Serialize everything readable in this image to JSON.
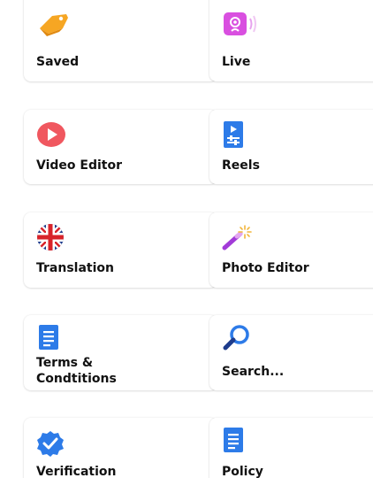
{
  "menu": {
    "items": [
      {
        "label": "Saved",
        "icon": "tag-icon",
        "color": "#F6A623"
      },
      {
        "label": "Live",
        "icon": "live-broadcast-icon",
        "color": "#D94FE0"
      },
      {
        "label": "Video Editor",
        "icon": "play-icon",
        "color": "#F0575F"
      },
      {
        "label": "Reels",
        "icon": "reels-icon",
        "color": "#2D7BE8"
      },
      {
        "label": "Translation",
        "icon": "uk-flag-icon",
        "color": "#1E3C8C"
      },
      {
        "label": "Photo Editor",
        "icon": "magic-wand-icon",
        "color": "#A23BD8"
      },
      {
        "label": "Terms &\nCondtitions",
        "label_line1": "Terms &",
        "label_line2": "Condtitions",
        "icon": "document-icon",
        "color": "#2D7BE8"
      },
      {
        "label": "Search...",
        "icon": "search-icon",
        "color": "#2D7BE8"
      },
      {
        "label": "Verification",
        "icon": "verified-badge-icon",
        "color": "#2D7BE8"
      },
      {
        "label": "Policy",
        "icon": "policy-document-icon",
        "color": "#2D7BE8"
      }
    ]
  }
}
